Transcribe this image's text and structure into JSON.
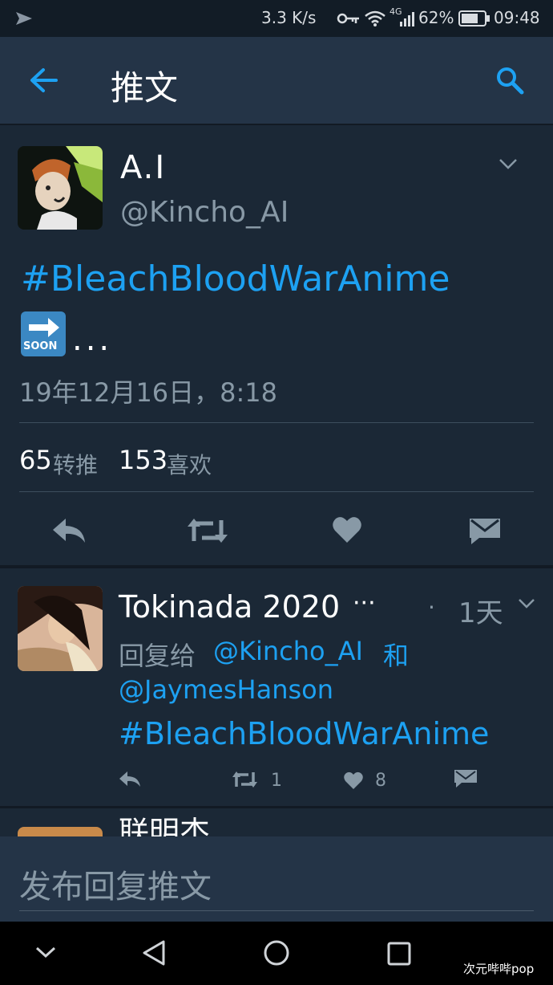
{
  "status_bar": {
    "speed": "3.3 K/s",
    "network": "4G",
    "battery": "62%",
    "time": "09:48",
    "icons": [
      "send-icon",
      "key-icon",
      "wifi-icon",
      "signal-icon",
      "battery-icon"
    ]
  },
  "header": {
    "title": "推文",
    "back_icon": "arrow-left-icon",
    "search_icon": "search-icon"
  },
  "tweet": {
    "author_name": "A.I",
    "author_handle": "@Kincho_AI",
    "text": "#BleachBloodWarAnime",
    "emoji_label": "SOON",
    "ellipsis": "...",
    "timestamp": "19年12月16日，8:18",
    "retweets": "65",
    "retweets_label": "转推",
    "likes": "153",
    "likes_label": "喜欢"
  },
  "reply": {
    "author_name": "Tokinada 2020",
    "more": "···",
    "dot": "·",
    "time": "1天",
    "reply_to_label": "回复给",
    "reply_to_user1": "@Kincho_AI",
    "reply_and": "和",
    "reply_to_user2": "@JaymesHanson",
    "text": "#BleachBloodWarAnime",
    "retweet_count": "1",
    "like_count": "8"
  },
  "next_tweet": {
    "author_name_partial": "联明杰"
  },
  "compose": {
    "placeholder": "发布回复推文"
  },
  "watermark": "次元哔哔pop",
  "colors": {
    "accent": "#1da1f2",
    "background": "#1b2836",
    "header": "#243447",
    "muted": "#8899a6"
  }
}
